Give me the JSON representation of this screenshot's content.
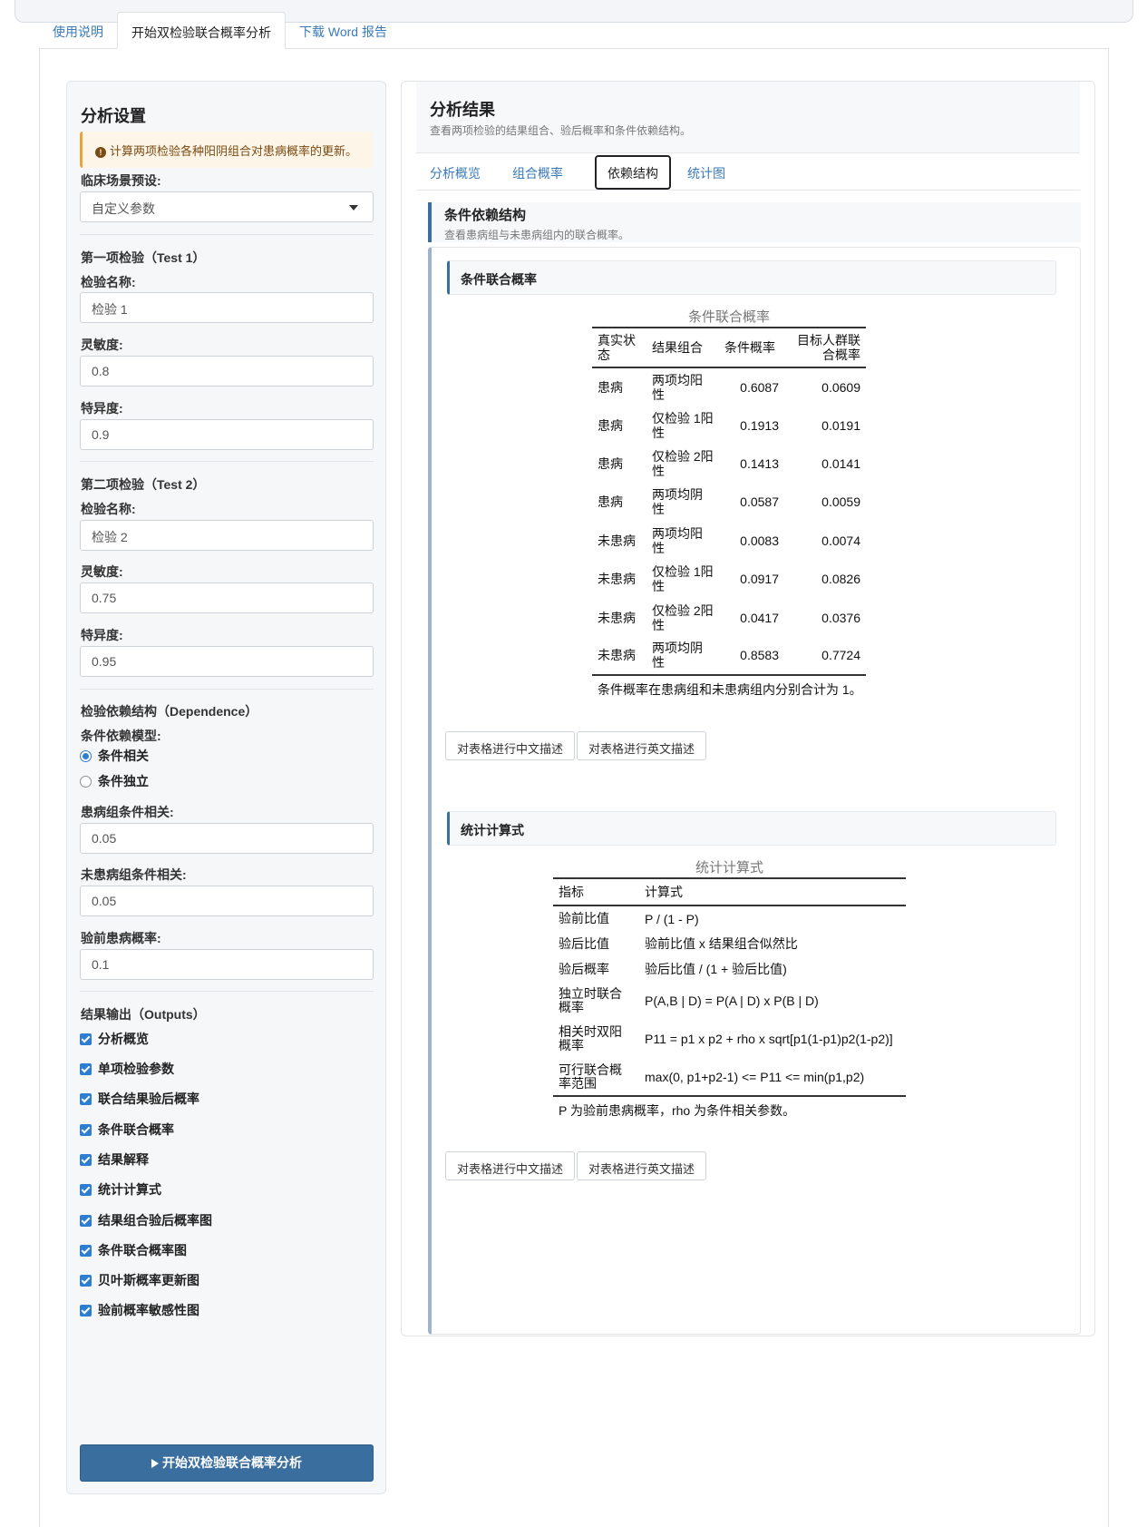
{
  "nav": {
    "tabs": [
      {
        "label": "使用说明"
      },
      {
        "label": "开始双检验联合概率分析"
      },
      {
        "label": "下载 Word 报告"
      }
    ]
  },
  "sidebar": {
    "title": "分析设置",
    "alert": "计算两项检验各种阳阴组合对患病概率的更新。",
    "preset_label": "临床场景预设:",
    "preset_value": "自定义参数",
    "test1": {
      "section": "第一项检验（Test 1）",
      "name_label": "检验名称:",
      "name_value": "检验 1",
      "sens_label": "灵敏度:",
      "sens_value": "0.8",
      "spec_label": "特异度:",
      "spec_value": "0.9"
    },
    "test2": {
      "section": "第二项检验（Test 2）",
      "name_label": "检验名称:",
      "name_value": "检验 2",
      "sens_label": "灵敏度:",
      "sens_value": "0.75",
      "spec_label": "特异度:",
      "spec_value": "0.95"
    },
    "dependence": {
      "section": "检验依赖结构（Dependence）",
      "model_label": "条件依赖模型:",
      "options": [
        "条件相关",
        "条件独立"
      ],
      "selected": "条件相关",
      "diseased_rho_label": "患病组条件相关:",
      "diseased_rho_value": "0.05",
      "nondiseased_rho_label": "未患病组条件相关:",
      "nondiseased_rho_value": "0.05",
      "prior_label": "验前患病概率:",
      "prior_value": "0.1"
    },
    "outputs": {
      "section": "结果输出（Outputs）",
      "items": [
        "分析概览",
        "单项检验参数",
        "联合结果验后概率",
        "条件联合概率",
        "结果解释",
        "统计计算式",
        "结果组合验后概率图",
        "条件联合概率图",
        "贝叶斯概率更新图",
        "验前概率敏感性图"
      ]
    },
    "run_button": "开始双检验联合概率分析"
  },
  "results": {
    "title": "分析结果",
    "subtitle": "查看两项检验的结果组合、验后概率和条件依赖结构。",
    "tabs": [
      "分析概览",
      "组合概率",
      "依赖结构",
      "统计图"
    ],
    "active_tab": "依赖结构",
    "section_title": "条件依赖结构",
    "section_subtitle": "查看患病组与未患病组内的联合概率。",
    "card1": {
      "title": "条件联合概率",
      "caption": "条件联合概率",
      "headers": [
        "真实状态",
        "结果组合",
        "条件概率",
        "目标人群联合概率"
      ],
      "rows": [
        [
          "患病",
          "两项均阳性",
          "0.6087",
          "0.0609"
        ],
        [
          "患病",
          "仅检验 1阳性",
          "0.1913",
          "0.0191"
        ],
        [
          "患病",
          "仅检验 2阳性",
          "0.1413",
          "0.0141"
        ],
        [
          "患病",
          "两项均阴性",
          "0.0587",
          "0.0059"
        ],
        [
          "未患病",
          "两项均阳性",
          "0.0083",
          "0.0074"
        ],
        [
          "未患病",
          "仅检验 1阳性",
          "0.0917",
          "0.0826"
        ],
        [
          "未患病",
          "仅检验 2阳性",
          "0.0417",
          "0.0376"
        ],
        [
          "未患病",
          "两项均阴性",
          "0.8583",
          "0.7724"
        ]
      ],
      "note": "条件概率在患病组和未患病组内分别合计为 1。",
      "btn_cn": "对表格进行中文描述",
      "btn_en": "对表格进行英文描述"
    },
    "card2": {
      "title": "统计计算式",
      "caption": "统计计算式",
      "headers": [
        "指标",
        "计算式"
      ],
      "rows": [
        [
          "验前比值",
          "P / (1 - P)"
        ],
        [
          "验后比值",
          "验前比值 x 结果组合似然比"
        ],
        [
          "验后概率",
          "验后比值 / (1 + 验后比值)"
        ],
        [
          "独立时联合概率",
          "P(A,B | D) = P(A | D) x P(B | D)"
        ],
        [
          "相关时双阳概率",
          "P11 = p1 x p2 + rho x sqrt[p1(1-p1)p2(1-p2)]"
        ],
        [
          "可行联合概率范围",
          "max(0, p1+p2-1) <= P11 <= min(p1,p2)"
        ]
      ],
      "note": "P 为验前患病概率，rho 为条件相关参数。",
      "btn_cn": "对表格进行中文描述",
      "btn_en": "对表格进行英文描述"
    }
  }
}
